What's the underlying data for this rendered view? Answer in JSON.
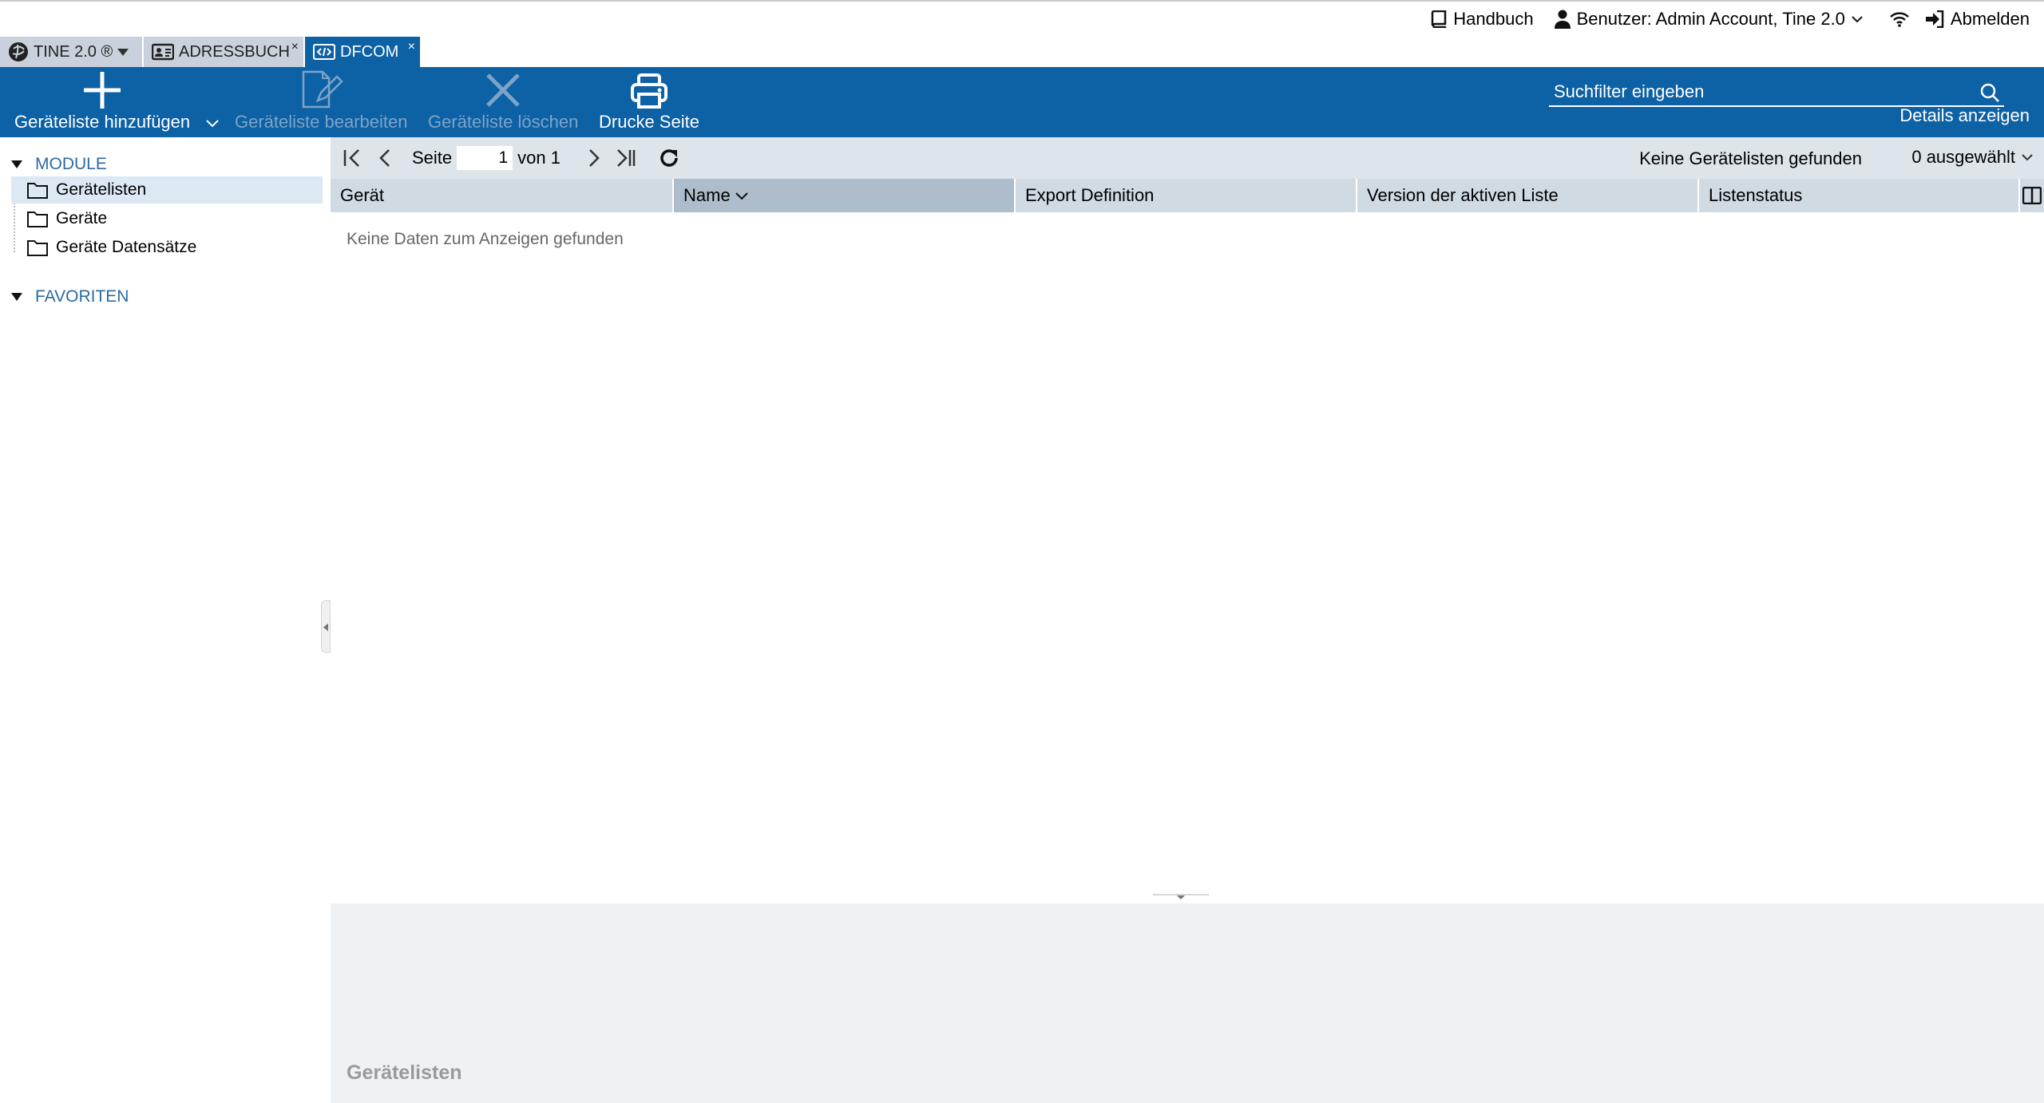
{
  "topbar": {
    "manual_label": "Handbuch",
    "user_label": "Benutzer: Admin Account, Tine 2.0",
    "logout_label": "Abmelden"
  },
  "apptabs": {
    "tine_label": "TINE 2.0 ®",
    "addressbook_label": "ADRESSBUCH",
    "dfcom_label": "DFCOM",
    "close_glyph": "×"
  },
  "toolbar": {
    "add_label": "Geräteliste hinzufügen",
    "edit_label": "Geräteliste bearbeiten",
    "delete_label": "Geräteliste löschen",
    "print_label": "Drucke Seite",
    "search_placeholder": "Suchfilter eingeben",
    "details_label": "Details anzeigen",
    "accent": "#0d61a5"
  },
  "sidebar": {
    "module_heading": "MODULE",
    "items": [
      {
        "label": "Gerätelisten",
        "selected": true
      },
      {
        "label": "Geräte",
        "selected": false
      },
      {
        "label": "Geräte Datensätze",
        "selected": false
      }
    ],
    "favorites_heading": "FAVORITEN"
  },
  "pager": {
    "page_label": "Seite",
    "page_value": "1",
    "of_label": "von 1",
    "status_text": "Keine Gerätelisten gefunden",
    "selected_text": "0 ausgewählt"
  },
  "grid": {
    "columns": [
      "Gerät",
      "Name",
      "Export Definition",
      "Version der aktiven Liste",
      "Listenstatus"
    ],
    "empty_text": "Keine Daten zum Anzeigen gefunden"
  },
  "details": {
    "title": "Gerätelisten"
  }
}
